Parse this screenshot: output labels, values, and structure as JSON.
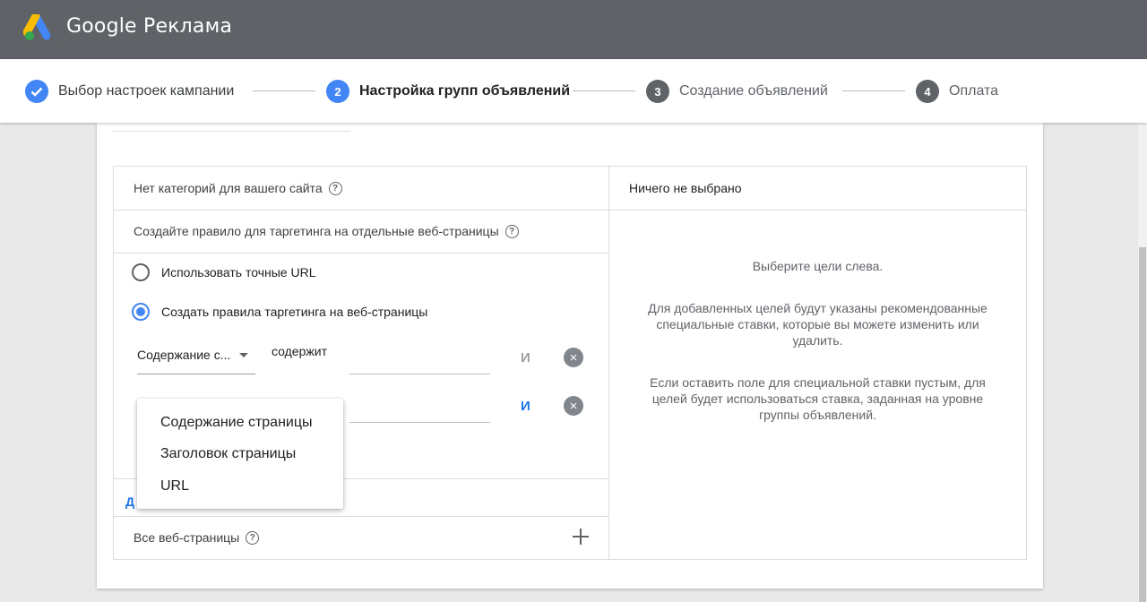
{
  "app": {
    "brand": "Google Реклама",
    "accent": "#4285f4",
    "topbar_color": "#5f6368"
  },
  "stepper": {
    "steps": [
      {
        "number": "✓",
        "label": "Выбор настроек кампании",
        "state": "done"
      },
      {
        "number": "2",
        "label": "Настройка групп объявлений",
        "state": "current"
      },
      {
        "number": "3",
        "label": "Создание объявлений",
        "state": "future"
      },
      {
        "number": "4",
        "label": "Оплата",
        "state": "future"
      }
    ]
  },
  "left_panel": {
    "categories_text": "Нет категорий для вашего сайта",
    "rule_header": "Создайте правило для таргетинга на отдельные веб-страницы",
    "radio_exact": "Использовать точные URL",
    "radio_rules": "Создать правила таргетинга на веб-страницы",
    "rule_field_value": "Содержание с...",
    "rule_operator": "содержит",
    "and_label": "И",
    "clear_icon": "×",
    "add_link_visible": "Д",
    "all_pages": "Все веб-страницы"
  },
  "right_panel": {
    "header": "Ничего не выбрано",
    "msg1": "Выберите цели слева.",
    "msg2": "Для добавленных целей будут указаны рекомендованные специальные ставки, которые вы можете изменить или удалить.",
    "msg3": "Если оставить поле для специальной ставки пустым, для целей будет использоваться ставка, заданная на уровне группы объявлений."
  },
  "dropdown_menu": {
    "options": [
      "Содержание страницы",
      "Заголовок страницы",
      "URL"
    ]
  }
}
